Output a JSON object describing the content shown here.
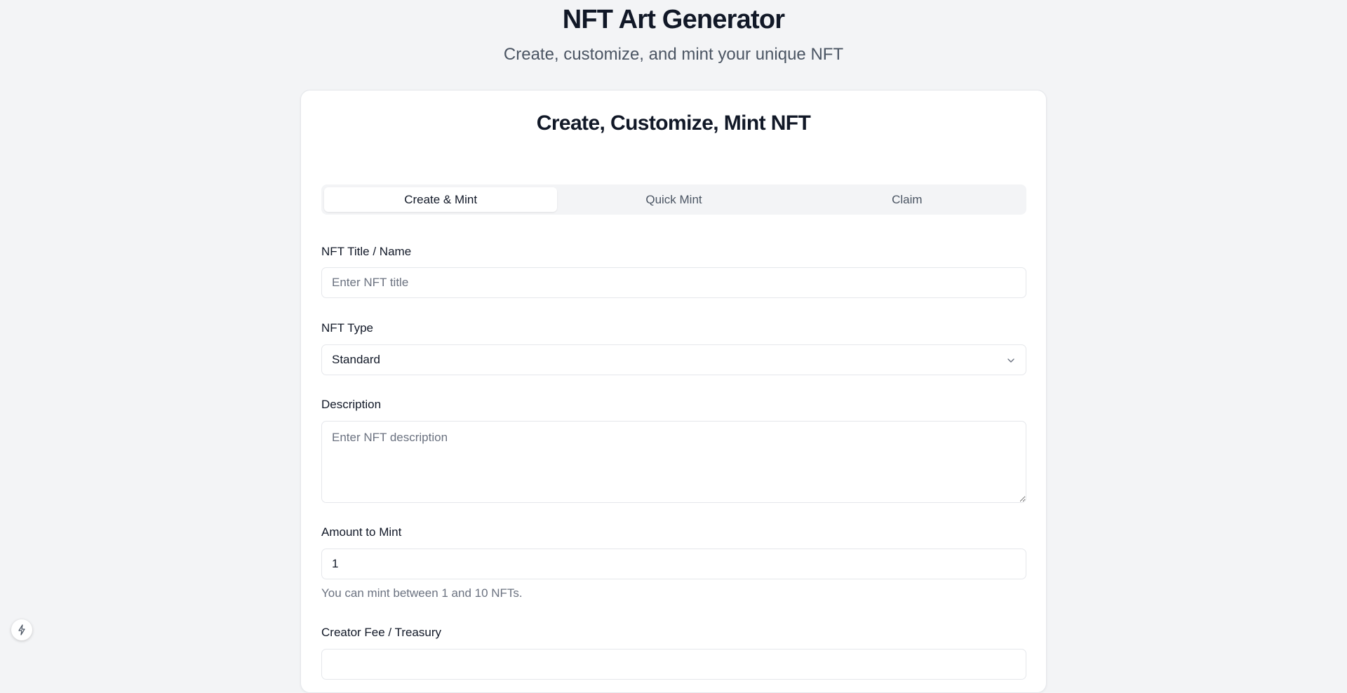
{
  "header": {
    "title": "NFT Art Generator",
    "subtitle": "Create, customize, and mint your unique NFT"
  },
  "card": {
    "title": "Create, Customize, Mint NFT",
    "tabs": [
      {
        "label": "Create & Mint",
        "active": true
      },
      {
        "label": "Quick Mint",
        "active": false
      },
      {
        "label": "Claim",
        "active": false
      }
    ]
  },
  "form": {
    "title_field": {
      "label": "NFT Title / Name",
      "placeholder": "Enter NFT title",
      "value": ""
    },
    "type_field": {
      "label": "NFT Type",
      "value": "Standard",
      "icon": "chevron-down-icon"
    },
    "description_field": {
      "label": "Description",
      "placeholder": "Enter NFT description",
      "value": ""
    },
    "amount_field": {
      "label": "Amount to Mint",
      "value": "1",
      "helper": "You can mint between 1 and 10 NFTs."
    },
    "creator_fee_field": {
      "label": "Creator Fee / Treasury"
    }
  },
  "floating_button": {
    "icon": "bolt-icon"
  }
}
